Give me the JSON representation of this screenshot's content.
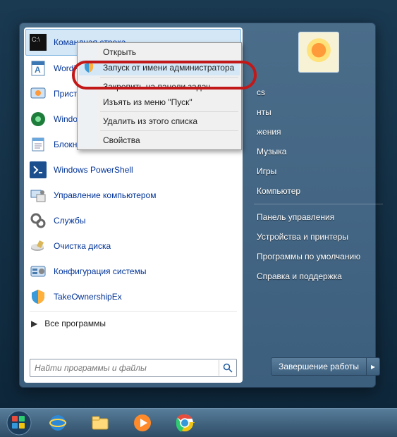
{
  "programs": [
    {
      "label": "Командная строка"
    },
    {
      "label": "WordPad"
    },
    {
      "label": "Приступая к работе"
    },
    {
      "label": "Windows Media Center"
    },
    {
      "label": "Блокнот"
    },
    {
      "label": "Windows PowerShell"
    },
    {
      "label": "Управление компьютером"
    },
    {
      "label": "Службы"
    },
    {
      "label": "Очистка диска"
    },
    {
      "label": "Конфигурация системы"
    },
    {
      "label": "TakeOwnershipEx"
    }
  ],
  "all_programs": "Все программы",
  "search": {
    "placeholder": "Найти программы и файлы"
  },
  "right": {
    "items_top": [
      "cs",
      "нты",
      "жения",
      "Музыка",
      "Игры",
      "Компьютер"
    ],
    "items_bottom": [
      "Панель управления",
      "Устройства и принтеры",
      "Программы по умолчанию",
      "Справка и поддержка"
    ]
  },
  "shutdown": {
    "label": "Завершение работы"
  },
  "context": {
    "items": [
      {
        "label": "Открыть"
      },
      {
        "label": "Запуск от имени администратора",
        "shield": true,
        "highlight": true
      },
      {
        "label": "Закрепить на панели задач"
      },
      {
        "label": "Изъять из меню \"Пуск\""
      },
      {
        "label": "Удалить из этого списка"
      },
      {
        "label": "Свойства"
      }
    ]
  }
}
